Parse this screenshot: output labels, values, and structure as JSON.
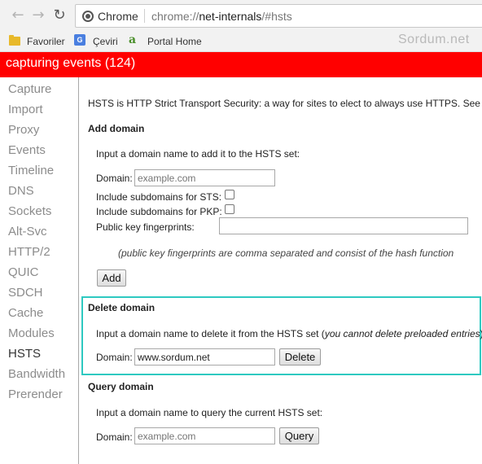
{
  "toolbar": {
    "back_glyph": "←",
    "forward_glyph": "→",
    "reload_glyph": "↻",
    "chip_label": "Chrome",
    "url_prefix": "chrome://",
    "url_host": "net-internals",
    "url_path": "/#hsts"
  },
  "bookmarks": {
    "items": [
      {
        "label": "Favoriler",
        "icon": "folder-icon"
      },
      {
        "label": "Çeviri",
        "icon": "google-translate-icon"
      },
      {
        "label": "Portal Home",
        "icon": "portal-icon"
      }
    ],
    "watermark": "Sordum.net"
  },
  "status": {
    "text": "capturing events (124)",
    "color": "#ff0000"
  },
  "sidebar": {
    "items": [
      {
        "label": "Capture"
      },
      {
        "label": "Import"
      },
      {
        "label": "Proxy"
      },
      {
        "label": "Events"
      },
      {
        "label": "Timeline"
      },
      {
        "label": "DNS"
      },
      {
        "label": "Sockets"
      },
      {
        "label": "Alt-Svc"
      },
      {
        "label": "HTTP/2"
      },
      {
        "label": "QUIC"
      },
      {
        "label": "SDCH"
      },
      {
        "label": "Cache"
      },
      {
        "label": "Modules"
      },
      {
        "label": "HSTS",
        "active": true
      },
      {
        "label": "Bandwidth"
      },
      {
        "label": "Prerender"
      }
    ]
  },
  "hsts": {
    "intro": "HSTS is HTTP Strict Transport Security: a way for sites to elect to always use HTTPS. See",
    "add": {
      "heading": "Add domain",
      "description": "Input a domain name to add it to the HSTS set:",
      "domain_label": "Domain:",
      "domain_placeholder": "example.com",
      "sts_label": "Include subdomains for STS:",
      "pkp_label": "Include subdomains for PKP:",
      "fingerprints_label": "Public key fingerprints:",
      "fingerprints_note": "(public key fingerprints are comma separated and consist of the hash function",
      "button": "Add"
    },
    "delete": {
      "heading": "Delete domain",
      "description_main": "Input a domain name to delete it from the HSTS set (",
      "description_note": "you cannot delete preloaded entries",
      "description_end": "):",
      "domain_label": "Domain:",
      "domain_value": "www.sordum.net",
      "button": "Delete",
      "highlight_color": "#2ec9c1"
    },
    "query": {
      "heading": "Query domain",
      "description": "Input a domain name to query the current HSTS set:",
      "domain_label": "Domain:",
      "domain_placeholder": "example.com",
      "button": "Query"
    }
  }
}
